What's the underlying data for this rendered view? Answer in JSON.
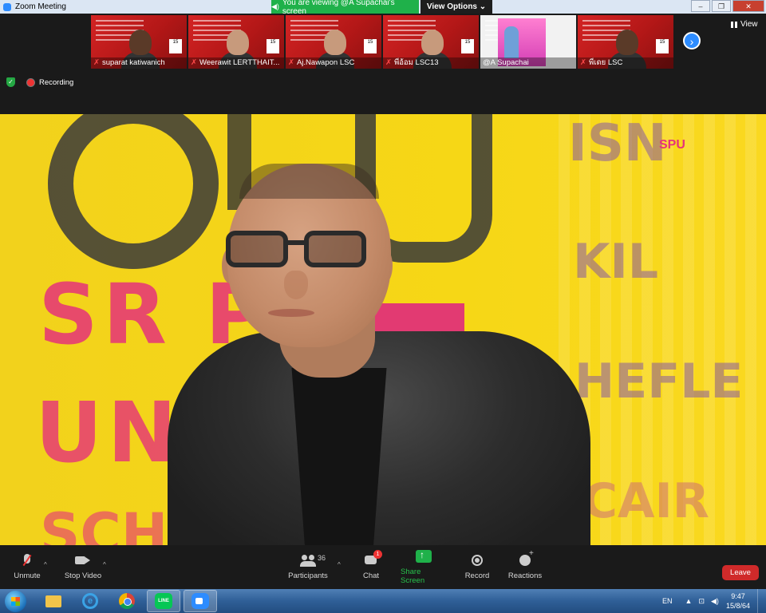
{
  "window": {
    "title": "Zoom Meeting"
  },
  "share_banner": {
    "text": "You are viewing @A Supachai's screen",
    "view_options": "View Options"
  },
  "view_button": {
    "label": "View"
  },
  "thumbnails": [
    {
      "name": "suparat katiwanich"
    },
    {
      "name": "Weerawit LERTTHAIT..."
    },
    {
      "name": "Aj.Nawapon LSC"
    },
    {
      "name": "พี่อ้อม LSC13"
    },
    {
      "name": "@A Supachai"
    },
    {
      "name": "พี่เดย LSC"
    }
  ],
  "status": {
    "recording_label": "Recording"
  },
  "video": {
    "logo_text": "SPU",
    "wall_text_1": "SR PA",
    "wall_text_2": "UN VE",
    "wall_text_3": "SCH",
    "side_text_1": "ISN",
    "side_text_2": "KIL",
    "side_text_3": "HEFLE",
    "side_text_4": "CAIR"
  },
  "toolbar": {
    "unmute": "Unmute",
    "stop_video": "Stop Video",
    "participants": "Participants",
    "participants_count": "36",
    "chat": "Chat",
    "chat_badge": "1",
    "share_screen": "Share Screen",
    "record": "Record",
    "reactions": "Reactions",
    "leave": "Leave"
  },
  "taskbar": {
    "line_label": "LINE",
    "language": "EN",
    "time": "9:47",
    "date": "15/8/64"
  },
  "colors": {
    "zoom_blue": "#2d8cff",
    "share_green": "#1fb14a",
    "leave_red": "#d02a2a",
    "wall_yellow": "#f4d51a",
    "wall_pink": "#e6337a"
  }
}
